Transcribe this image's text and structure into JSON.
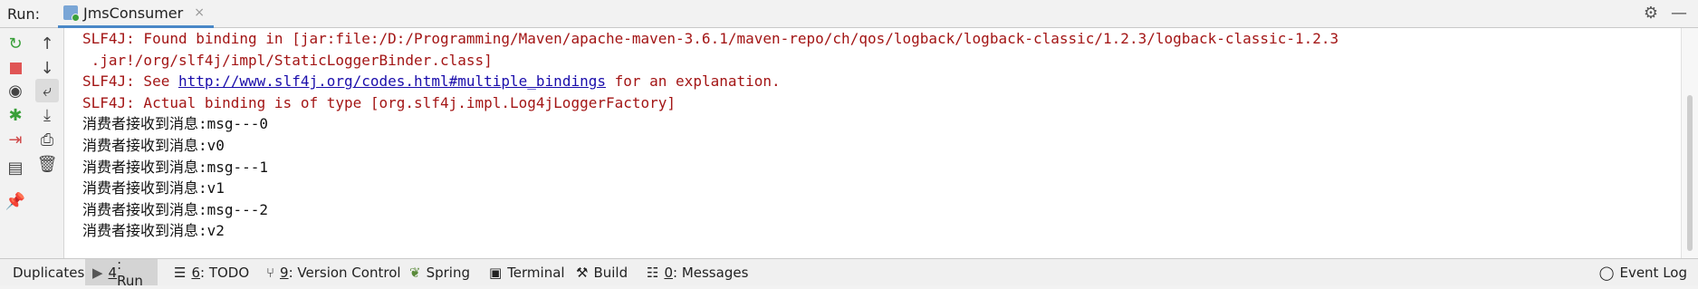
{
  "runbar": {
    "label": "Run:",
    "tab": {
      "title": "JmsConsumer",
      "close": "×"
    },
    "icons": [
      "gear-icon",
      "minimize-icon"
    ]
  },
  "console": {
    "lines": [
      {
        "text": "SLF4J: Found binding in [jar:file:/D:/Programming/Maven/apache-maven-3.6.1/maven-repo/ch/qos/logback/logback-classic/1.2.3/logback-classic-1.2.3",
        "color": "red"
      },
      {
        "text": " .jar!/org/slf4j/impl/StaticLoggerBinder.class]",
        "color": "red"
      },
      {
        "prefix": "SLF4J: See ",
        "link": "http://www.slf4j.org/codes.html#multiple_bindings",
        "suffix": " for an explanation.",
        "color": "red"
      },
      {
        "text": "SLF4J: Actual binding is of type [org.slf4j.impl.Log4jLoggerFactory]",
        "color": "red"
      },
      {
        "text": "消费者接收到消息:msg---0",
        "color": "black"
      },
      {
        "text": "消费者接收到消息:v0",
        "color": "black"
      },
      {
        "text": "消费者接收到消息:msg---1",
        "color": "black"
      },
      {
        "text": "消费者接收到消息:v1",
        "color": "black"
      },
      {
        "text": "消费者接收到消息:msg---2",
        "color": "black"
      },
      {
        "text": "消费者接收到消息:v2",
        "color": "black"
      }
    ]
  },
  "statusbar": {
    "items": [
      {
        "key": "",
        "label": "Duplicates"
      },
      {
        "key": "4",
        "label": ": Run"
      },
      {
        "key": "6",
        "label": ": TODO"
      },
      {
        "key": "9",
        "label": ": Version Control"
      },
      {
        "key": "",
        "label": "Spring"
      },
      {
        "key": "",
        "label": "Terminal"
      },
      {
        "key": "",
        "label": "Build"
      },
      {
        "key": "0",
        "label": ": Messages"
      }
    ],
    "event_log": "Event Log"
  },
  "colors": {
    "red_text": "#a31515",
    "link": "#1a0dab",
    "tab_underline": "#4a88c7"
  }
}
